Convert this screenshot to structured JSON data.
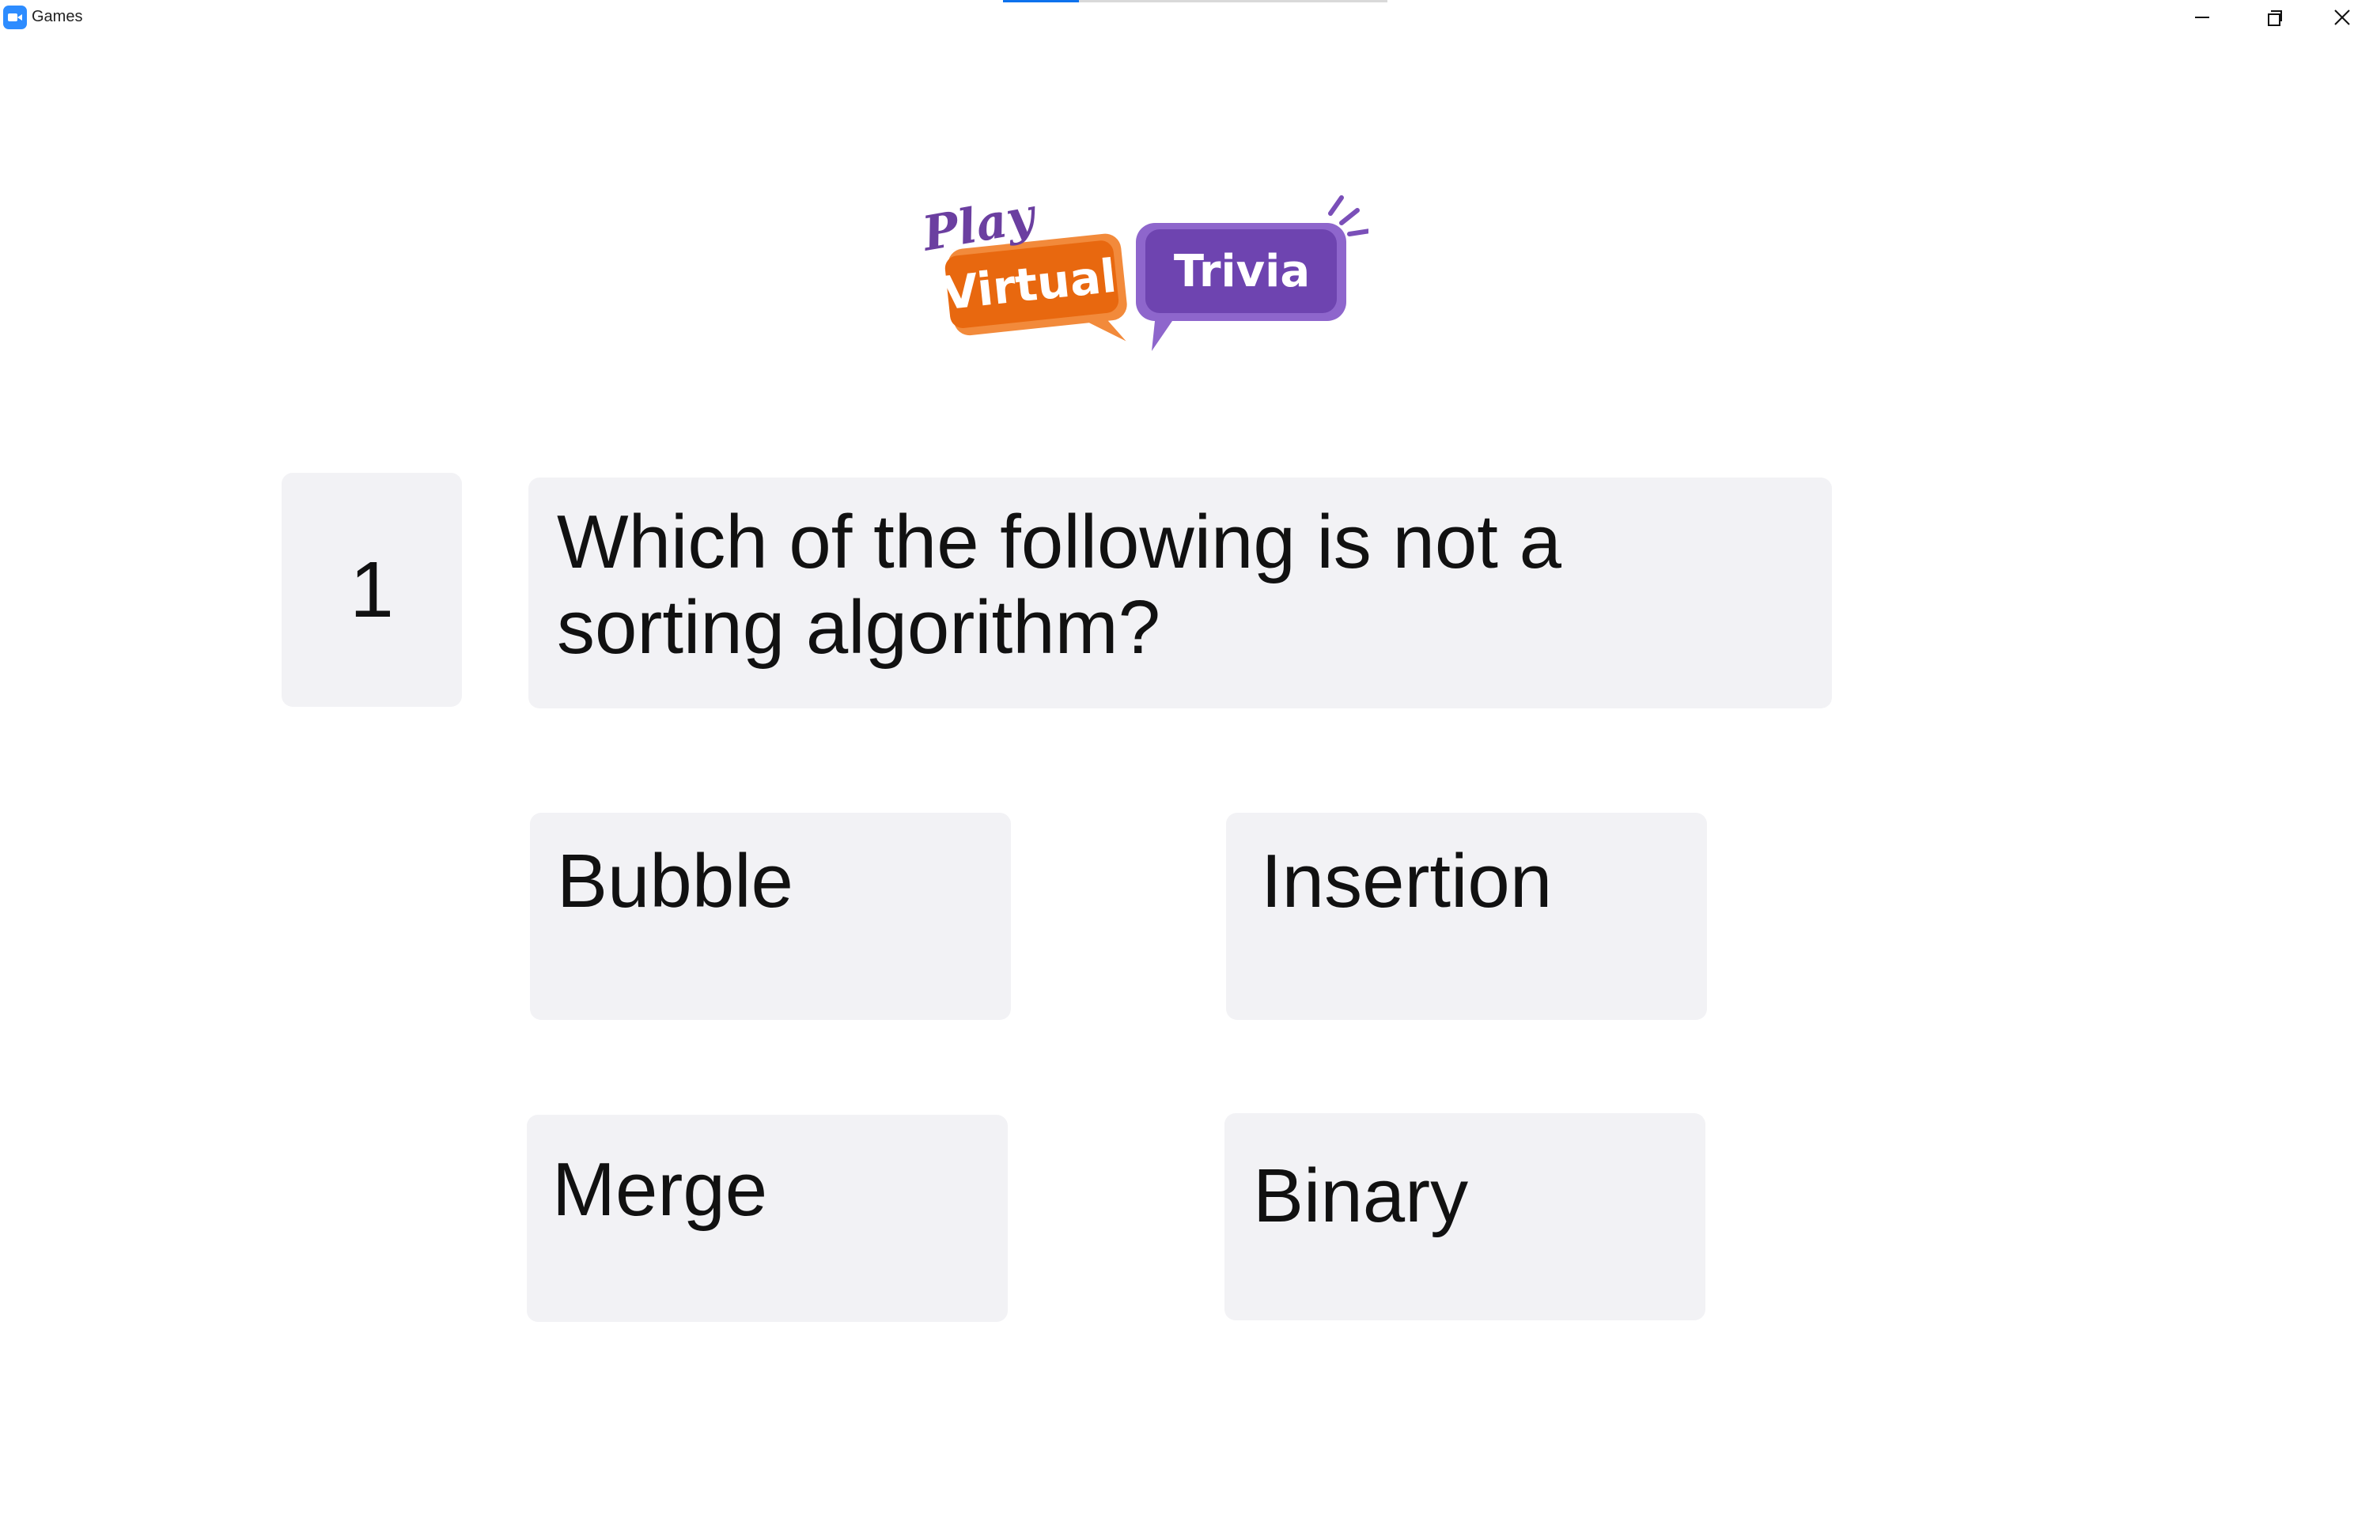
{
  "window": {
    "title": "Games",
    "controls": {
      "minimize": "minimize-icon",
      "restore": "restore-icon",
      "close": "close-icon"
    }
  },
  "logo": {
    "play": "Play",
    "virtual": "Virtual",
    "trivia": "Trivia",
    "colors": {
      "play": "#6b3fa0",
      "virtual_bubble": "#ee7623",
      "trivia_bubble": "#7a4fb8"
    }
  },
  "trivia": {
    "question_number": "1",
    "question": "Which of the following is not a sorting algorithm?",
    "answers": [
      "Bubble",
      "Insertion",
      "Merge",
      "Binary"
    ]
  }
}
